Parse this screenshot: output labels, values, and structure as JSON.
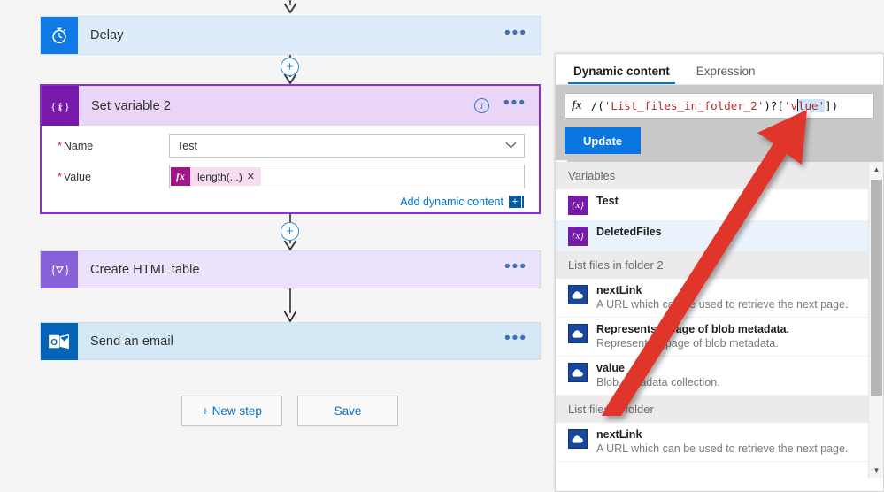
{
  "designer": {
    "steps": [
      {
        "title": "Delay",
        "icon": "timer-icon",
        "ellipsis": "•••"
      },
      {
        "title": "Set variable 2",
        "icon": "variable-icon",
        "ellipsis": "•••",
        "info": "i"
      },
      {
        "title": "Create HTML table",
        "icon": "data-operations-icon",
        "ellipsis": "•••"
      },
      {
        "title": "Send an email",
        "icon": "outlook-icon",
        "ellipsis": "•••"
      }
    ],
    "set_variable": {
      "name_label": "Name",
      "name_value": "Test",
      "value_label": "Value",
      "value_token": "length(...)",
      "token_close": "✕",
      "required_star": "*",
      "add_dynamic_content": "Add dynamic content",
      "add_plus": "+"
    },
    "buttons": {
      "new_step": "+ New step",
      "save": "Save"
    },
    "plus_glyph": "+"
  },
  "panel": {
    "tabs": [
      {
        "label": "Dynamic content",
        "active": true
      },
      {
        "label": "Expression",
        "active": false
      }
    ],
    "expression": {
      "fx": "fx",
      "prefix": "/(",
      "string1": "'List_files_in_folder_2'",
      "mid": ")?[",
      "string2_pre": "'v",
      "string2_sel": "lue'",
      "suffix": "])"
    },
    "update_button": "Update",
    "groups": [
      {
        "title": "Variables",
        "items": [
          {
            "name": "Test",
            "desc": "",
            "icon": "variable-icon",
            "highlight": false
          },
          {
            "name": "DeletedFiles",
            "desc": "",
            "icon": "variable-icon",
            "highlight": true
          }
        ]
      },
      {
        "title": "List files in folder 2",
        "items": [
          {
            "name": "nextLink",
            "desc": "A URL which can be used to retrieve the next page.",
            "icon": "azure-blob-icon",
            "highlight": false
          },
          {
            "name": "Represents a page of blob metadata.",
            "desc": "Represents a page of blob metadata.",
            "icon": "azure-blob-icon",
            "highlight": false
          },
          {
            "name": "value",
            "desc": "Blob metadata collection.",
            "icon": "azure-blob-icon",
            "highlight": false
          }
        ]
      },
      {
        "title": "List files in folder",
        "items": [
          {
            "name": "nextLink",
            "desc": "A URL which can be used to retrieve the next page.",
            "icon": "azure-blob-icon",
            "highlight": false
          }
        ]
      }
    ],
    "scrollbar": {
      "up": "▲",
      "down": "▼"
    },
    "collapse_chevron": "‹"
  },
  "colors": {
    "accent_blue": "#0078d4",
    "purple": "#7719aa",
    "annotation_red": "#e0342a",
    "outlook_blue": "#0364b8",
    "blob_blue": "#17489e"
  }
}
